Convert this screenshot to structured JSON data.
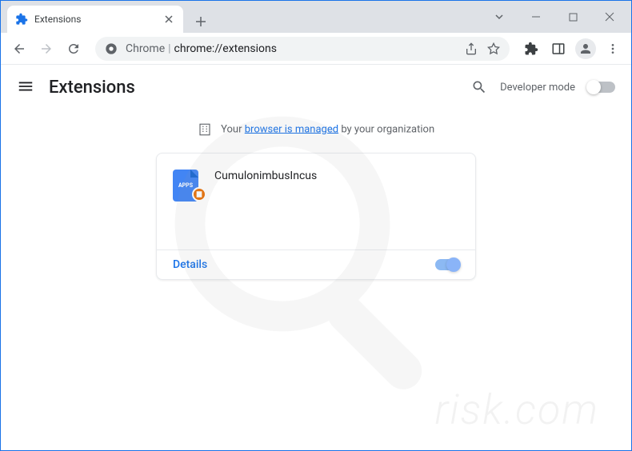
{
  "window": {
    "tab_title": "Extensions"
  },
  "toolbar": {
    "url_prefix": "Chrome",
    "url_path": "chrome://extensions"
  },
  "page": {
    "title": "Extensions",
    "dev_mode_label": "Developer mode",
    "managed_prefix": "Your",
    "managed_link": "browser is managed",
    "managed_suffix": "by your organization"
  },
  "extension": {
    "name": "CumulonimbusIncus",
    "icon_label": "APPS",
    "details_btn": "Details",
    "enabled": true
  },
  "watermark": {
    "text": "risk.com"
  }
}
